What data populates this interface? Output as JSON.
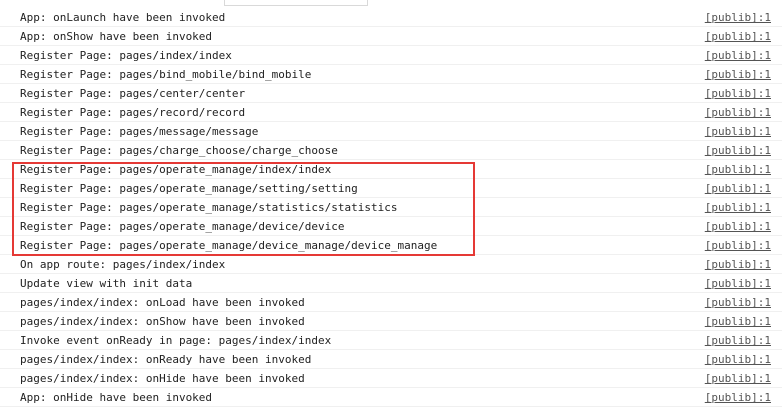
{
  "console": {
    "rows": [
      {
        "message": "App: onLaunch have been invoked",
        "source": "[publib]:1"
      },
      {
        "message": "App: onShow have been invoked",
        "source": "[publib]:1"
      },
      {
        "message": "Register Page: pages/index/index",
        "source": "[publib]:1"
      },
      {
        "message": "Register Page: pages/bind_mobile/bind_mobile",
        "source": "[publib]:1"
      },
      {
        "message": "Register Page: pages/center/center",
        "source": "[publib]:1"
      },
      {
        "message": "Register Page: pages/record/record",
        "source": "[publib]:1"
      },
      {
        "message": "Register Page: pages/message/message",
        "source": "[publib]:1"
      },
      {
        "message": "Register Page: pages/charge_choose/charge_choose",
        "source": "[publib]:1"
      },
      {
        "message": "Register Page: pages/operate_manage/index/index",
        "source": "[publib]:1"
      },
      {
        "message": "Register Page: pages/operate_manage/setting/setting",
        "source": "[publib]:1"
      },
      {
        "message": "Register Page: pages/operate_manage/statistics/statistics",
        "source": "[publib]:1"
      },
      {
        "message": "Register Page: pages/operate_manage/device/device",
        "source": "[publib]:1"
      },
      {
        "message": "Register Page: pages/operate_manage/device_manage/device_manage",
        "source": "[publib]:1"
      },
      {
        "message": "On app route: pages/index/index",
        "source": "[publib]:1"
      },
      {
        "message": "Update view with init data",
        "source": "[publib]:1"
      },
      {
        "message": "pages/index/index: onLoad have been invoked",
        "source": "[publib]:1"
      },
      {
        "message": "pages/index/index: onShow have been invoked",
        "source": "[publib]:1"
      },
      {
        "message": "Invoke event onReady in page: pages/index/index",
        "source": "[publib]:1"
      },
      {
        "message": "pages/index/index: onReady have been invoked",
        "source": "[publib]:1"
      },
      {
        "message": "pages/index/index: onHide have been invoked",
        "source": "[publib]:1"
      },
      {
        "message": "App: onHide have been invoked",
        "source": "[publib]:1"
      }
    ]
  },
  "highlight": {
    "color": "#e53935"
  }
}
